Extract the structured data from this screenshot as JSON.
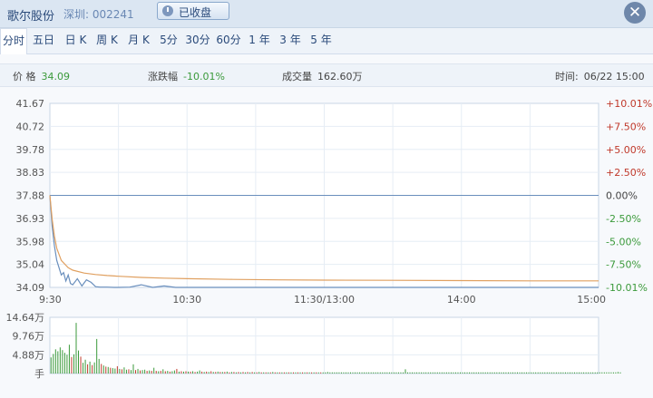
{
  "header": {
    "stock_name": "歌尔股份",
    "exchange_code": "深圳: 002241",
    "status_label": "已收盘",
    "status_icon": "clock-icon",
    "close_icon": "close-icon"
  },
  "tabs": [
    {
      "label": "分时",
      "active": true
    },
    {
      "label": "五日"
    },
    {
      "label": "日 K"
    },
    {
      "label": "周 K"
    },
    {
      "label": "月 K"
    },
    {
      "label": "5分"
    },
    {
      "label": "30分"
    },
    {
      "label": "60分"
    },
    {
      "label": "1 年"
    },
    {
      "label": "3 年"
    },
    {
      "label": "5 年"
    }
  ],
  "info": {
    "price_label": "价 格",
    "price_value": "34.09",
    "change_label": "涨跌幅",
    "change_value": "-10.01%",
    "volume_label": "成交量",
    "volume_value": "162.60万",
    "time_label": "时间:",
    "time_value": "06/22 15:00"
  },
  "colors": {
    "price_line": "#6a8fbd",
    "avg_line": "#e0a060",
    "up": "#c0392b",
    "down": "#3b9a3b",
    "ref": "#6a8fbd"
  },
  "chart_data": [
    {
      "type": "line",
      "x_tick_labels": [
        "9:30",
        "10:30",
        "11:30/13:00",
        "14:00",
        "15:00"
      ],
      "y_tick_labels_left": [
        "41.67",
        "40.72",
        "39.78",
        "38.83",
        "37.88",
        "36.93",
        "35.98",
        "35.04",
        "34.09"
      ],
      "y_tick_labels_right": [
        "+10.01%",
        "+7.50%",
        "+5.00%",
        "+2.50%",
        "0.00%",
        "-2.50%",
        "-5.00%",
        "-7.50%",
        "-10.01%"
      ],
      "ylim": [
        34.09,
        41.67
      ],
      "reference_price": 37.88,
      "x_range_minutes": [
        0,
        240
      ],
      "series": [
        {
          "key": "price",
          "x": [
            0,
            1,
            2,
            3,
            4,
            5,
            6,
            7,
            8,
            9,
            10,
            12,
            14,
            16,
            18,
            20,
            22,
            25,
            28,
            30,
            35,
            40,
            45,
            50,
            55,
            60,
            70,
            80,
            90,
            100,
            110,
            120,
            140,
            160,
            180,
            200,
            220,
            240
          ],
          "y": [
            37.88,
            36.6,
            35.8,
            35.2,
            34.9,
            34.6,
            34.7,
            34.35,
            34.6,
            34.25,
            34.2,
            34.45,
            34.15,
            34.4,
            34.3,
            34.12,
            34.1,
            34.1,
            34.09,
            34.09,
            34.1,
            34.2,
            34.09,
            34.15,
            34.09,
            34.09,
            34.09,
            34.09,
            34.09,
            34.09,
            34.09,
            34.09,
            34.09,
            34.09,
            34.09,
            34.09,
            34.09,
            34.09
          ]
        },
        {
          "key": "avg",
          "x": [
            0,
            1,
            2,
            3,
            5,
            8,
            10,
            15,
            20,
            25,
            30,
            40,
            50,
            60,
            80,
            100,
            120,
            150,
            180,
            210,
            240
          ],
          "y": [
            37.88,
            36.9,
            36.2,
            35.7,
            35.2,
            34.9,
            34.8,
            34.68,
            34.62,
            34.58,
            34.55,
            34.5,
            34.47,
            34.45,
            34.42,
            34.4,
            34.39,
            34.38,
            34.37,
            34.36,
            34.36
          ]
        }
      ]
    },
    {
      "type": "bar",
      "y_tick_labels": [
        "14.64万",
        "9.76万",
        "4.88万",
        "手"
      ],
      "ylim": [
        0,
        14.64
      ],
      "y_unit": "万手",
      "bars_per_session_minute": 1,
      "values": [
        4.2,
        5.1,
        6.3,
        5.8,
        6.8,
        6.1,
        5.4,
        4.9,
        7.5,
        4.3,
        5.0,
        13.2,
        6.0,
        4.4,
        2.8,
        3.6,
        2.4,
        3.1,
        2.2,
        2.9,
        9.0,
        3.8,
        2.5,
        2.1,
        1.8,
        1.7,
        1.5,
        1.4,
        1.3,
        1.9,
        1.2,
        1.1,
        1.6,
        1.0,
        1.1,
        0.9,
        2.4,
        0.9,
        1.2,
        0.8,
        0.9,
        1.0,
        0.7,
        0.8,
        0.7,
        1.5,
        0.7,
        0.6,
        0.7,
        1.1,
        0.6,
        0.7,
        0.5,
        0.6,
        0.8,
        1.2,
        0.5,
        0.6,
        0.5,
        0.6,
        0.5,
        0.5,
        0.6,
        0.4,
        0.5,
        0.8,
        0.5,
        0.4,
        0.5,
        0.4,
        0.6,
        0.4,
        0.4,
        0.5,
        0.4,
        0.4,
        0.4,
        0.5,
        0.3,
        0.4,
        0.4,
        0.3,
        0.4,
        0.3,
        0.4,
        0.3,
        0.4,
        0.3,
        0.4,
        0.3,
        0.3,
        0.4,
        0.3,
        0.3,
        0.3,
        0.3,
        0.3,
        0.4,
        0.3,
        0.3,
        0.3,
        0.3,
        0.3,
        0.3,
        0.3,
        0.3,
        0.3,
        0.3,
        0.3,
        0.3,
        0.3,
        0.3,
        0.3,
        0.3,
        0.3,
        0.3,
        0.3,
        0.3,
        0.3,
        0.3,
        0.3,
        0.4,
        0.3,
        0.3,
        0.3,
        0.3,
        0.3,
        0.3,
        0.3,
        0.3,
        0.3,
        0.3,
        0.3,
        0.3,
        0.3,
        0.3,
        0.3,
        0.3,
        0.3,
        0.3,
        0.3,
        0.3,
        0.3,
        0.3,
        0.3,
        0.3,
        0.3,
        0.3,
        0.3,
        0.3,
        0.3,
        0.3,
        0.3,
        0.3,
        0.3,
        1.1,
        0.3,
        0.3,
        0.3,
        0.3,
        0.3,
        0.3,
        0.3,
        0.3,
        0.3,
        0.3,
        0.3,
        0.3,
        0.3,
        0.3,
        0.3,
        0.3,
        0.3,
        0.3,
        0.3,
        0.3,
        0.3,
        0.3,
        0.3,
        0.3,
        0.3,
        0.3,
        0.3,
        0.3,
        0.3,
        0.3,
        0.3,
        0.3,
        0.3,
        0.3,
        0.3,
        0.3,
        0.3,
        0.3,
        0.3,
        0.3,
        0.3,
        0.3,
        0.3,
        0.3,
        0.3,
        0.3,
        0.3,
        0.3,
        0.3,
        0.3,
        0.3,
        0.3,
        0.3,
        0.3,
        0.3,
        0.3,
        0.3,
        0.3,
        0.3,
        0.3,
        0.3,
        0.3,
        0.3,
        0.3,
        0.3,
        0.3,
        0.3,
        0.3,
        0.3,
        0.3,
        0.3,
        0.3,
        0.3,
        0.3,
        0.3,
        0.3,
        0.3,
        0.3,
        0.3,
        0.3,
        0.3,
        0.3,
        0.3,
        0.3,
        0.3,
        0.3,
        0.3,
        0.3,
        0.3,
        0.3,
        0.3,
        0.3,
        0.4,
        0.3
      ],
      "colors": [
        "down",
        "down",
        "down",
        "down",
        "down",
        "down",
        "down",
        "down",
        "down",
        "up",
        "down",
        "down",
        "down",
        "up",
        "down",
        "down",
        "up",
        "down",
        "up",
        "down",
        "down",
        "down",
        "up",
        "down",
        "up",
        "down",
        "up",
        "down",
        "down",
        "up",
        "down",
        "up",
        "down",
        "down",
        "up",
        "down",
        "down",
        "up",
        "down",
        "up",
        "down",
        "down",
        "up",
        "down",
        "up",
        "down",
        "up",
        "down",
        "up",
        "down",
        "up",
        "down",
        "up",
        "down",
        "down",
        "up",
        "down",
        "up",
        "down",
        "up",
        "down",
        "up",
        "down",
        "up",
        "down",
        "down",
        "up",
        "down",
        "up",
        "down",
        "up",
        "down",
        "up",
        "down",
        "up",
        "down",
        "up",
        "down",
        "up",
        "down",
        "up",
        "down",
        "up",
        "down",
        "up",
        "down",
        "up",
        "down",
        "up",
        "down",
        "up",
        "down",
        "up",
        "down",
        "up",
        "down",
        "up",
        "down",
        "up",
        "down",
        "up",
        "down",
        "up",
        "down",
        "up",
        "down",
        "up",
        "down",
        "up",
        "down",
        "up",
        "down",
        "up",
        "down",
        "up",
        "down",
        "up",
        "down",
        "up",
        "down"
      ]
    }
  ]
}
